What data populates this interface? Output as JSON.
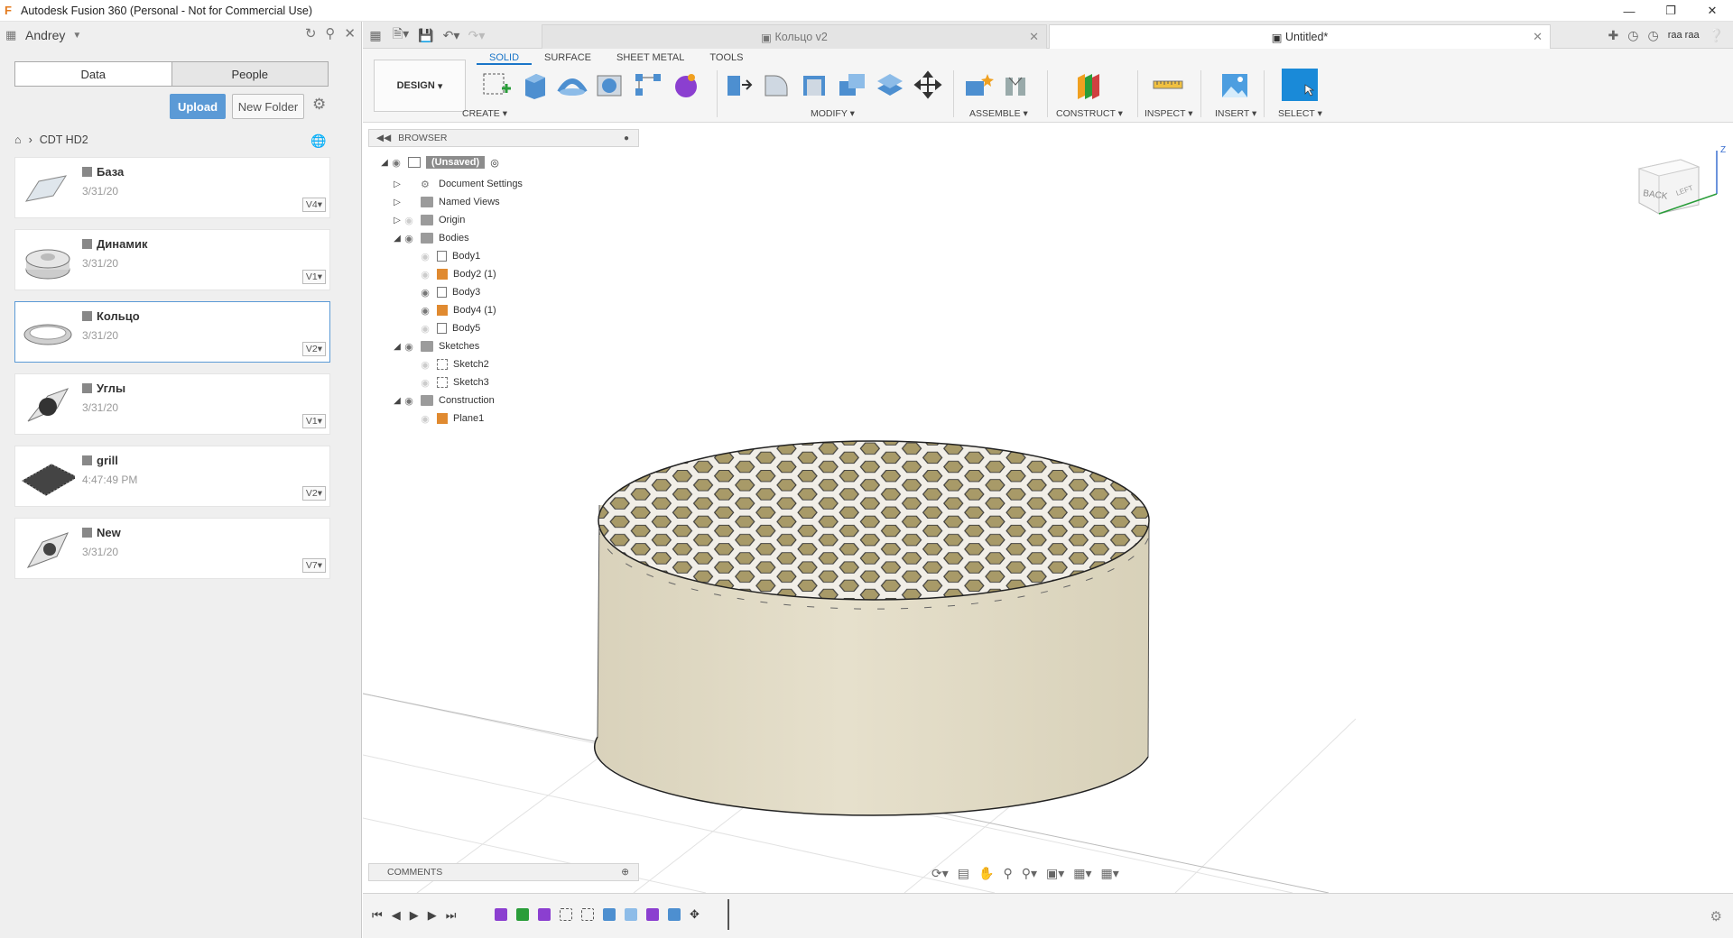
{
  "window": {
    "title": "Autodesk Fusion 360 (Personal - Not for Commercial Use)",
    "logo": "F"
  },
  "data_panel": {
    "user": "Andrey",
    "tabs": [
      "Data",
      "People"
    ],
    "upload_label": "Upload",
    "new_folder_label": "New Folder",
    "breadcrumb": "CDT HD2",
    "files": [
      {
        "name": "База",
        "date": "3/31/20",
        "version": "V4"
      },
      {
        "name": "Динамик",
        "date": "3/31/20",
        "version": "V1"
      },
      {
        "name": "Кольцо",
        "date": "3/31/20",
        "version": "V2"
      },
      {
        "name": "Углы",
        "date": "3/31/20",
        "version": "V1"
      },
      {
        "name": "grill",
        "date": "4:47:49 PM",
        "version": "V2"
      },
      {
        "name": "New",
        "date": "3/31/20",
        "version": "V7"
      }
    ]
  },
  "doc_tabs": [
    {
      "label": "Кольцо v2",
      "active": false
    },
    {
      "label": "Untitled*",
      "active": true
    }
  ],
  "header_user": "raa raa",
  "toolbar": {
    "workspace": "DESIGN",
    "tabs": [
      "SOLID",
      "SURFACE",
      "SHEET METAL",
      "TOOLS"
    ],
    "groups": [
      "CREATE",
      "MODIFY",
      "ASSEMBLE",
      "CONSTRUCT",
      "INSPECT",
      "INSERT",
      "SELECT"
    ]
  },
  "browser": {
    "title": "BROWSER",
    "root": "(Unsaved)",
    "items": [
      {
        "label": "Document Settings",
        "level": 1
      },
      {
        "label": "Named Views",
        "level": 1
      },
      {
        "label": "Origin",
        "level": 1
      },
      {
        "label": "Bodies",
        "level": 1
      },
      {
        "label": "Body1",
        "level": 2
      },
      {
        "label": "Body2 (1)",
        "level": 2
      },
      {
        "label": "Body3",
        "level": 2
      },
      {
        "label": "Body4 (1)",
        "level": 2
      },
      {
        "label": "Body5",
        "level": 2
      },
      {
        "label": "Sketches",
        "level": 1
      },
      {
        "label": "Sketch2",
        "level": 2
      },
      {
        "label": "Sketch3",
        "level": 2
      },
      {
        "label": "Construction",
        "level": 1
      },
      {
        "label": "Plane1",
        "level": 2
      }
    ]
  },
  "comments_label": "COMMENTS",
  "viewcube": {
    "face1": "BACK",
    "face2": "LEFT",
    "axis": "Z"
  },
  "colors": {
    "accent": "#1a75c8",
    "body": "#ddd7c4",
    "grill": "#f2efe8",
    "upload": "#5b9ad6"
  }
}
